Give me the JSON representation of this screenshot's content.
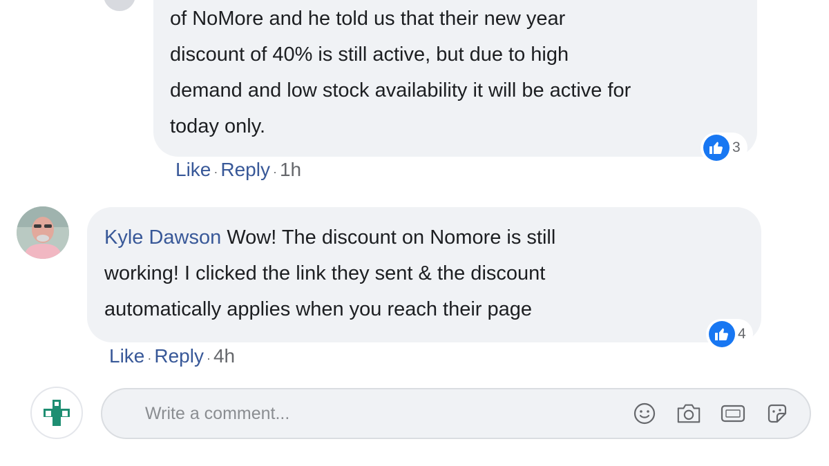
{
  "comments": [
    {
      "author": "",
      "lines": [
        "of NoMore and he told us that their new year",
        "discount of 40% is still active, but due to high",
        "demand and low stock availability it will be active for",
        "today only."
      ],
      "reaction_count": "3",
      "actions": {
        "like": "Like",
        "reply": "Reply",
        "separator": "·",
        "time": "1h"
      }
    },
    {
      "author": "Kyle Dawson",
      "lines": [
        "Wow! The discount on Nomore is still",
        "working! I clicked the link they sent & the discount",
        "automatically applies when you reach their page"
      ],
      "reaction_count": "4",
      "actions": {
        "like": "Like",
        "reply": "Reply",
        "separator": "·",
        "time": "4h"
      }
    }
  ],
  "composer": {
    "placeholder": "Write a comment...",
    "icons": [
      "emoji-icon",
      "camera-icon",
      "gif-icon",
      "sticker-icon"
    ]
  },
  "colors": {
    "bubble": "#f0f2f5",
    "author": "#385898",
    "like_blue": "#1877f2",
    "muted": "#65676b"
  }
}
